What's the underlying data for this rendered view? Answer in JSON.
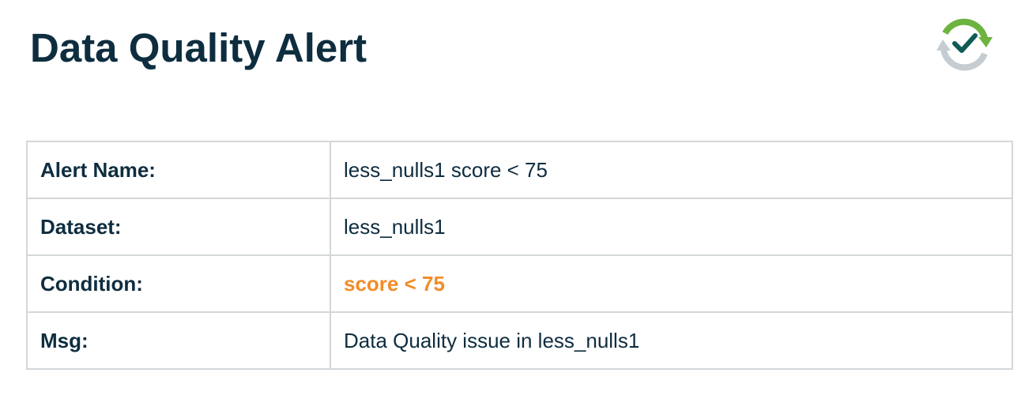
{
  "header": {
    "title": "Data Quality Alert"
  },
  "logo": {
    "icon": "refresh-check-icon",
    "colors": {
      "green": "#6cb33f",
      "gray": "#c5cdd2",
      "check": "#0e5c55"
    }
  },
  "alert": {
    "rows": [
      {
        "label": "Alert Name:",
        "value": "less_nulls1 score < 75"
      },
      {
        "label": "Dataset:",
        "value": "less_nulls1"
      },
      {
        "label": "Condition:",
        "value": "score < 75"
      },
      {
        "label": "Msg:",
        "value": "Data Quality issue in less_nulls1"
      }
    ]
  },
  "colors": {
    "text": "#0e2d3f",
    "condition": "#f28c28",
    "border": "#d3d7da"
  }
}
